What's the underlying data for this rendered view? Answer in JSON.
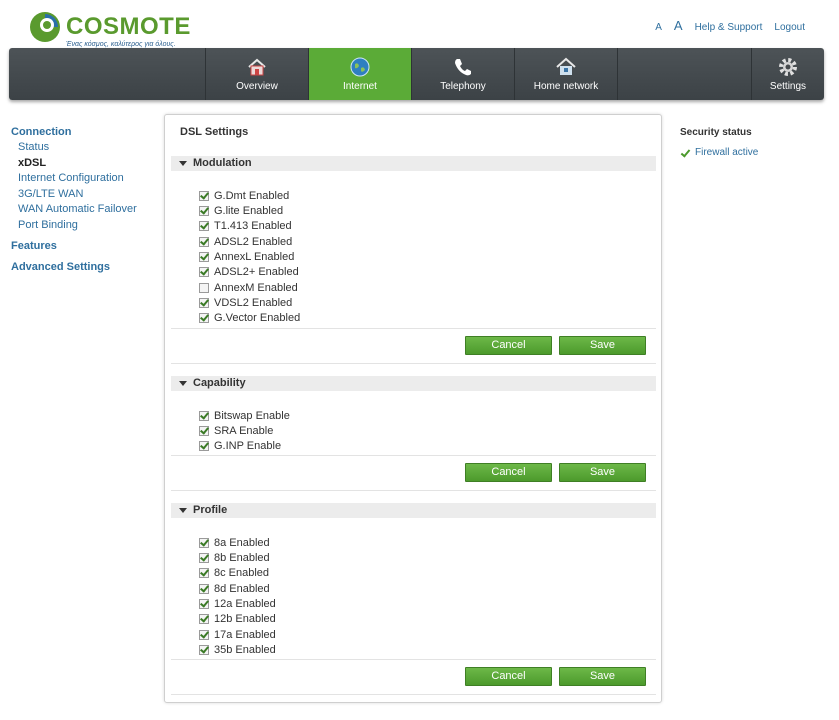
{
  "brand": {
    "name": "COSMOTE",
    "tagline": "Ένας κόσμος, καλύτερος για όλους."
  },
  "top_links": {
    "font_small": "A",
    "font_large": "A",
    "help": "Help & Support",
    "logout": "Logout"
  },
  "nav": {
    "overview": "Overview",
    "internet": "Internet",
    "telephony": "Telephony",
    "home_network": "Home network",
    "settings": "Settings",
    "active": "Internet",
    "accent_color": "#5bab37"
  },
  "sidebar": {
    "connection": "Connection",
    "items": [
      "Status",
      "xDSL",
      "Internet Configuration",
      "3G/LTE WAN",
      "WAN Automatic Failover",
      "Port Binding"
    ],
    "current": "xDSL",
    "features": "Features",
    "advanced": "Advanced Settings"
  },
  "panel": {
    "title": "DSL Settings",
    "modulation": {
      "title": "Modulation",
      "options": [
        {
          "label": "G.Dmt Enabled",
          "checked": true
        },
        {
          "label": "G.lite Enabled",
          "checked": true
        },
        {
          "label": "T1.413 Enabled",
          "checked": true
        },
        {
          "label": "ADSL2 Enabled",
          "checked": true
        },
        {
          "label": "AnnexL Enabled",
          "checked": true
        },
        {
          "label": "ADSL2+ Enabled",
          "checked": true
        },
        {
          "label": "AnnexM Enabled",
          "checked": false
        },
        {
          "label": "VDSL2 Enabled",
          "checked": true
        },
        {
          "label": "G.Vector Enabled",
          "checked": true
        }
      ]
    },
    "capability": {
      "title": "Capability",
      "options": [
        {
          "label": "Bitswap Enable",
          "checked": true
        },
        {
          "label": "SRA Enable",
          "checked": true
        },
        {
          "label": "G.INP Enable",
          "checked": true
        }
      ]
    },
    "profile": {
      "title": "Profile",
      "options": [
        {
          "label": "8a Enabled",
          "checked": true
        },
        {
          "label": "8b Enabled",
          "checked": true
        },
        {
          "label": "8c Enabled",
          "checked": true
        },
        {
          "label": "8d Enabled",
          "checked": true
        },
        {
          "label": "12a Enabled",
          "checked": true
        },
        {
          "label": "12b Enabled",
          "checked": true
        },
        {
          "label": "17a Enabled",
          "checked": true
        },
        {
          "label": "35b Enabled",
          "checked": true
        }
      ]
    },
    "buttons": {
      "cancel": "Cancel",
      "save": "Save"
    }
  },
  "security": {
    "title": "Security status",
    "firewall": "Firewall active"
  }
}
